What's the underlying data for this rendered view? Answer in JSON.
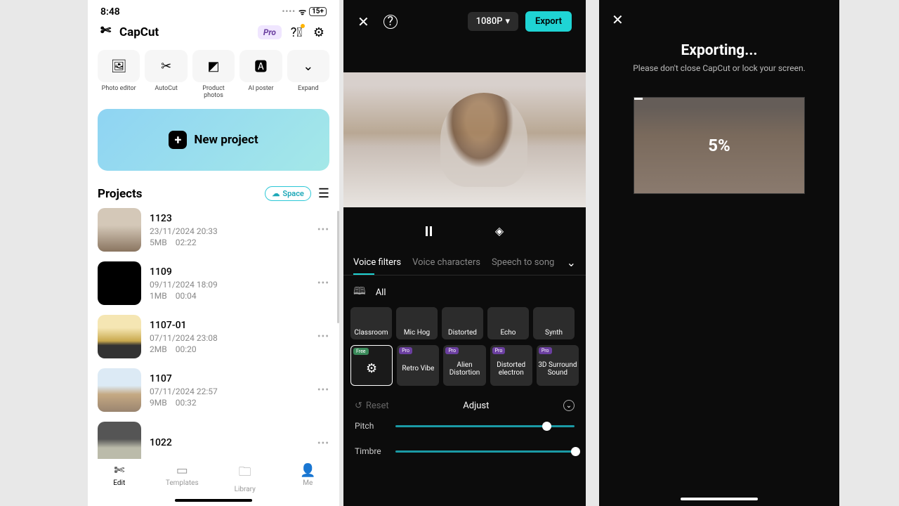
{
  "left": {
    "status": {
      "time": "8:48",
      "battery": "15+"
    },
    "brand": "CapCut",
    "pro": "Pro",
    "tools": [
      {
        "label": "Photo editor",
        "icon": "🖼"
      },
      {
        "label": "AutoCut",
        "icon": "✂"
      },
      {
        "label": "Product photos",
        "icon": "◩"
      },
      {
        "label": "AI poster",
        "icon": "🅰"
      },
      {
        "label": "Expand",
        "icon": "⌄"
      }
    ],
    "new_project": "New project",
    "projects_title": "Projects",
    "space_label": "Space",
    "projects": [
      {
        "name": "1123",
        "date": "23/11/2024 20:33",
        "size": "5MB",
        "dur": "02:22",
        "thumb": "t1"
      },
      {
        "name": "1109",
        "date": "09/11/2024 18:09",
        "size": "1MB",
        "dur": "00:04",
        "thumb": "t2"
      },
      {
        "name": "1107-01",
        "date": "07/11/2024 23:08",
        "size": "2MB",
        "dur": "00:20",
        "thumb": "t3"
      },
      {
        "name": "1107",
        "date": "07/11/2024 22:57",
        "size": "9MB",
        "dur": "00:32",
        "thumb": "t4"
      },
      {
        "name": "1022",
        "date": "",
        "size": "",
        "dur": "",
        "thumb": "t5"
      }
    ],
    "nav": [
      {
        "label": "Edit",
        "icon": "✄",
        "active": true
      },
      {
        "label": "Templates",
        "icon": "▭",
        "active": false
      },
      {
        "label": "Library",
        "icon": "🗀",
        "active": false
      },
      {
        "label": "Me",
        "icon": "👤",
        "active": false
      }
    ]
  },
  "mid": {
    "resolution": "1080P",
    "export_label": "Export",
    "tabs": [
      {
        "label": "Voice filters",
        "active": true
      },
      {
        "label": "Voice characters",
        "active": false
      },
      {
        "label": "Speech to song",
        "active": false
      }
    ],
    "category_all": "All",
    "filters_row1": [
      "Classroom",
      "Mic Hog",
      "Distorted",
      "Echo",
      "Synth"
    ],
    "filters_row2": [
      {
        "label": "",
        "badge": "Free",
        "badgeCls": "free",
        "sel": true,
        "icon": true
      },
      {
        "label": "Retro Vibe",
        "badge": "Pro",
        "badgeCls": "pro"
      },
      {
        "label": "Alien Distortion",
        "badge": "Pro",
        "badgeCls": "pro"
      },
      {
        "label": "Distorted electron",
        "badge": "Pro",
        "badgeCls": "pro"
      },
      {
        "label": "3D Surround Sound",
        "badge": "Pro",
        "badgeCls": "pro"
      }
    ],
    "reset": "Reset",
    "adjust": "Adjust",
    "sliders": [
      {
        "label": "Pitch",
        "pct": 82
      },
      {
        "label": "Timbre",
        "pct": 98
      }
    ]
  },
  "right": {
    "title": "Exporting...",
    "subtitle": "Please don't close CapCut or lock your screen.",
    "progress_pct": "5%",
    "progress_val": 5
  }
}
